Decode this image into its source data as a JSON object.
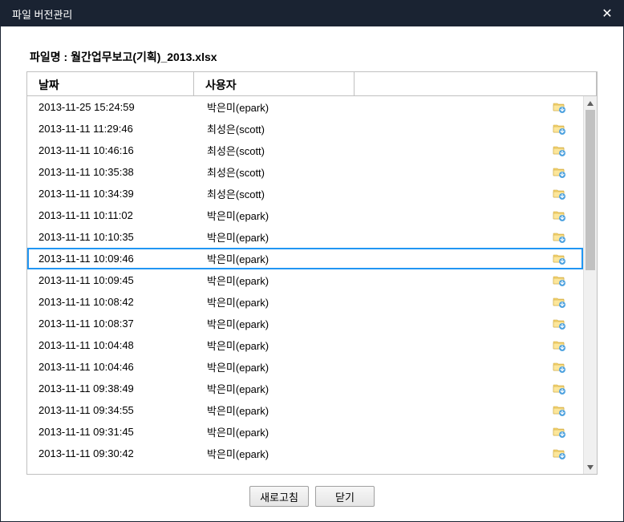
{
  "window": {
    "title": "파일 버전관리"
  },
  "filename_label_prefix": "파일명 : ",
  "filename": "월간업무보고(기획)_2013.xlsx",
  "columns": {
    "date": "날짜",
    "user": "사용자"
  },
  "rows": [
    {
      "date": "2013-11-25 15:24:59",
      "user": "박은미(epark)",
      "selected": false
    },
    {
      "date": "2013-11-11 11:29:46",
      "user": "최성은(scott)",
      "selected": false
    },
    {
      "date": "2013-11-11 10:46:16",
      "user": "최성은(scott)",
      "selected": false
    },
    {
      "date": "2013-11-11 10:35:38",
      "user": "최성은(scott)",
      "selected": false
    },
    {
      "date": "2013-11-11 10:34:39",
      "user": "최성은(scott)",
      "selected": false
    },
    {
      "date": "2013-11-11 10:11:02",
      "user": "박은미(epark)",
      "selected": false
    },
    {
      "date": "2013-11-11 10:10:35",
      "user": "박은미(epark)",
      "selected": false
    },
    {
      "date": "2013-11-11 10:09:46",
      "user": "박은미(epark)",
      "selected": true
    },
    {
      "date": "2013-11-11 10:09:45",
      "user": "박은미(epark)",
      "selected": false
    },
    {
      "date": "2013-11-11 10:08:42",
      "user": "박은미(epark)",
      "selected": false
    },
    {
      "date": "2013-11-11 10:08:37",
      "user": "박은미(epark)",
      "selected": false
    },
    {
      "date": "2013-11-11 10:04:48",
      "user": "박은미(epark)",
      "selected": false
    },
    {
      "date": "2013-11-11 10:04:46",
      "user": "박은미(epark)",
      "selected": false
    },
    {
      "date": "2013-11-11 09:38:49",
      "user": "박은미(epark)",
      "selected": false
    },
    {
      "date": "2013-11-11 09:34:55",
      "user": "박은미(epark)",
      "selected": false
    },
    {
      "date": "2013-11-11 09:31:45",
      "user": "박은미(epark)",
      "selected": false
    },
    {
      "date": "2013-11-11 09:30:42",
      "user": "박은미(epark)",
      "selected": false
    }
  ],
  "buttons": {
    "refresh": "새로고침",
    "close": "닫기"
  }
}
